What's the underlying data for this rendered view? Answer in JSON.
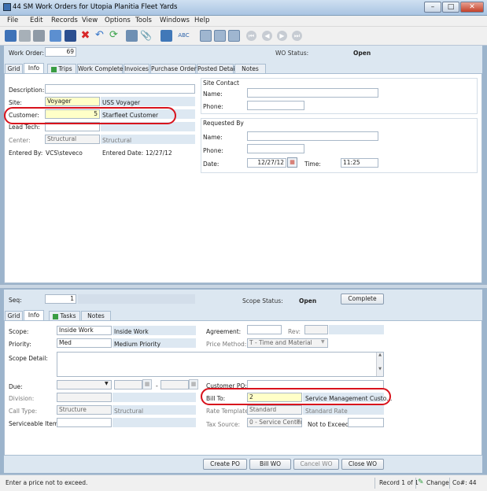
{
  "window": {
    "title": "44 SM Work Orders for Utopia Planitia Fleet Yards"
  },
  "menu": [
    "File",
    "Edit",
    "Records",
    "View",
    "Options",
    "Tools",
    "Windows",
    "Help"
  ],
  "header": {
    "wo_label": "Work Order:",
    "wo_value": "69",
    "status_label": "WO Status:",
    "status_value": "Open"
  },
  "top_tabs": [
    "Grid",
    "Info",
    "Trips",
    "Work Completed",
    "Invoices",
    "Purchase Orders",
    "Posted Detail",
    "Notes"
  ],
  "info": {
    "description_label": "Description:",
    "description_value": "",
    "site_label": "Site:",
    "site_value": "Voyager",
    "site_desc": "USS Voyager",
    "customer_label": "Customer:",
    "customer_value": "5",
    "customer_desc": "Starfleet Customer",
    "leadtech_label": "Lead Tech:",
    "leadtech_value": "",
    "center_label": "Center:",
    "center_value": "Structural",
    "center_desc": "Structural",
    "enteredby_label": "Entered By:",
    "enteredby_value": "VCS\\steveco",
    "entereddate_label": "Entered Date:",
    "entereddate_value": "12/27/12"
  },
  "site_contact": {
    "title": "Site Contact",
    "name_label": "Name:",
    "name_value": "",
    "phone_label": "Phone:",
    "phone_value": ""
  },
  "requested_by": {
    "title": "Requested By",
    "name_label": "Name:",
    "name_value": "",
    "phone_label": "Phone:",
    "phone_value": "",
    "date_label": "Date:",
    "date_value": "12/27/12",
    "time_label": "Time:",
    "time_value": "11:25"
  },
  "scope_header": {
    "seq_label": "Seq:",
    "seq_value": "1",
    "status_label": "Scope Status:",
    "status_value": "Open",
    "complete_button": "Complete"
  },
  "scope_tabs": [
    "Grid",
    "Info",
    "Tasks",
    "Notes"
  ],
  "scope": {
    "scope_label": "Scope:",
    "scope_value": "Inside Work",
    "scope_desc": "Inside Work",
    "priority_label": "Priority:",
    "priority_value": "Med",
    "priority_desc": "Medium Priority",
    "detail_label": "Scope Detail:",
    "detail_value": "",
    "due_label": "Due:",
    "due_value": "",
    "due_dash": "-",
    "division_label": "Division:",
    "division_value": "",
    "calltype_label": "Call Type:",
    "calltype_value": "Structure",
    "calltype_desc": "Structural",
    "serviceable_label": "Serviceable Item:",
    "serviceable_value": "",
    "agreement_label": "Agreement:",
    "agreement_value": "",
    "rev_label": "Rev:",
    "rev_value": "",
    "pricemethod_label": "Price Method:",
    "pricemethod_value": "T - Time and Material",
    "customerpo_label": "Customer PO:",
    "customerpo_value": "",
    "billto_label": "Bill To:",
    "billto_value": "2",
    "billto_desc": "Service Management Custo...",
    "ratetemplate_label": "Rate Template:",
    "ratetemplate_value": "Standard",
    "ratetemplate_desc": "Standard Rate",
    "taxsource_label": "Tax Source:",
    "taxsource_value": "0 - Service Center",
    "nte_label": "Not to Exceed:",
    "nte_value": ""
  },
  "actions": [
    "Create PO",
    "Bill WO",
    "Cancel WO",
    "Close WO"
  ],
  "status": {
    "message": "Enter a price not to exceed.",
    "record": "Record 1 of 1",
    "change": "Change",
    "company": "Co#: 44"
  }
}
